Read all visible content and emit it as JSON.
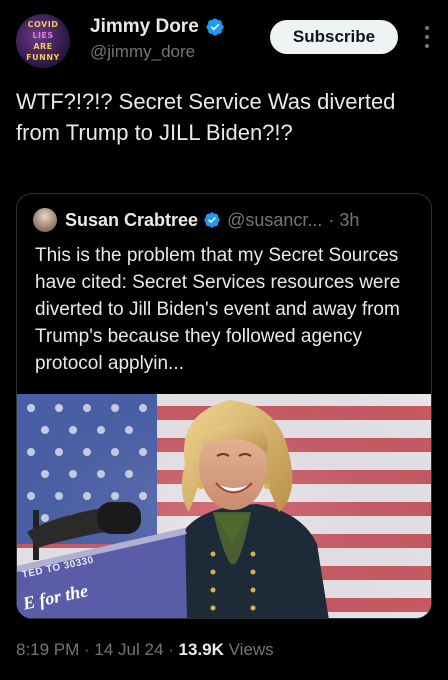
{
  "author": {
    "avatar_lines": [
      "COVID",
      "LIES",
      "ARE",
      "FUNNY"
    ],
    "display_name": "Jimmy Dore",
    "handle": "@jimmy_dore",
    "verified_color": "#1d9bf0"
  },
  "actions": {
    "subscribe_label": "Subscribe",
    "more_icon": "more-vertical-icon"
  },
  "tweet": {
    "text": "WTF?!?!? Secret Service Was diverted from Trump to JILL Biden?!?"
  },
  "quoted": {
    "display_name": "Susan Crabtree",
    "handle": "@susancr...",
    "time": "· 3h",
    "text": "This is the problem that my Secret Sources have cited: Secret Services resources were diverted to Jill Biden's event and away from Trump's because they followed agency protocol applyin...",
    "image": {
      "sign_line1": "TED TO 30330",
      "sign_line2": "E for the"
    }
  },
  "meta": {
    "time": "8:19 PM",
    "sep1": " · ",
    "date": "14 Jul 24",
    "sep2": " · ",
    "views_count": "13.9K",
    "views_label": " Views"
  }
}
